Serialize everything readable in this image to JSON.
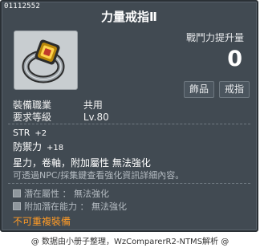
{
  "item": {
    "id": "01112552",
    "name": "力量戒指Ⅱ",
    "icon": "ring-icon",
    "power_label": "戰鬥力提升量",
    "power_value": "0",
    "tags": [
      "飾品",
      "戒指"
    ]
  },
  "requirements": {
    "job_label": "裝備職業",
    "job_value": "共用",
    "level_label": "要求等級",
    "level_value": "Lv.80"
  },
  "stats": [
    {
      "name": "STR",
      "value": "+2"
    },
    {
      "name": "防禦力",
      "value": "+18"
    }
  ],
  "properties": "星力，卷軸，附加屬性 無法強化",
  "enhance_info": "可透過NPC/採集鍵查看強化資訊詳細內容。",
  "potentials": [
    {
      "label": "潛在屬性 ： 無法強化"
    },
    {
      "label": "附加潛在能力 ： 無法強化"
    }
  ],
  "restriction": "不可重複裝備",
  "footer": "@ 数据由小册子整理，WzComparerR2-NTMS解析 @",
  "colors": {
    "background": "#414a52",
    "restriction": "#ff9b26",
    "secondary_text": "#b4bbc1"
  }
}
